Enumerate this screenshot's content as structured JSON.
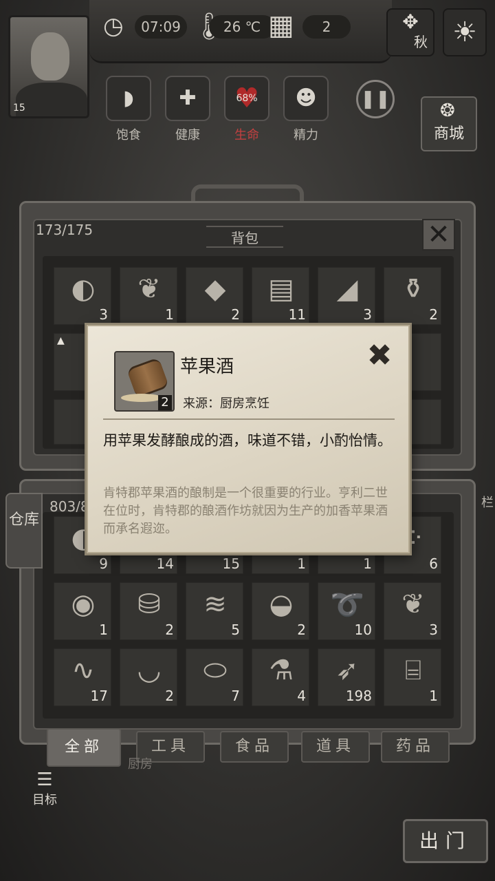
{
  "hud": {
    "time": "07:09",
    "temperature": "26 ℃",
    "day": "2",
    "season": "秋",
    "player_level": "15",
    "stats": [
      {
        "label": "饱食",
        "icon": "stomach-icon",
        "glyph": "◗",
        "value": ""
      },
      {
        "label": "健康",
        "icon": "health-cross-icon",
        "glyph": "✚",
        "value": ""
      },
      {
        "label": "生命",
        "icon": "heart-icon",
        "glyph": "♥",
        "value": "68%"
      },
      {
        "label": "精力",
        "icon": "energy-person-icon",
        "glyph": "☻",
        "value": ""
      }
    ],
    "shop_label": "商城"
  },
  "backpack": {
    "title": "背包",
    "capacity": "173/175",
    "slots": [
      {
        "name": "bread",
        "glyph": "◐",
        "qty": "3"
      },
      {
        "name": "herb-branch",
        "glyph": "❦",
        "qty": "1"
      },
      {
        "name": "stone",
        "glyph": "◆",
        "qty": "2"
      },
      {
        "name": "wood-planks",
        "glyph": "▤",
        "qty": "11"
      },
      {
        "name": "stone-shard",
        "glyph": "◢",
        "qty": "3"
      },
      {
        "name": "bottle",
        "glyph": "⚱",
        "qty": "2"
      }
    ]
  },
  "warehouse": {
    "tab_label": "仓库",
    "capacity_visible": "803/8",
    "row1_qty": [
      "9",
      "14",
      "15",
      "1",
      "1",
      "6"
    ],
    "slots": [
      {
        "name": "soup-bowl",
        "glyph": "◉",
        "qty": "1"
      },
      {
        "name": "apple-cider",
        "glyph": "⛁",
        "qty": "2"
      },
      {
        "name": "cloth",
        "glyph": "≋",
        "qty": "5"
      },
      {
        "name": "grain-bowl",
        "glyph": "◒",
        "qty": "2"
      },
      {
        "name": "rope",
        "glyph": "➰",
        "qty": "10"
      },
      {
        "name": "herb-branch",
        "glyph": "❦",
        "qty": "3"
      },
      {
        "name": "bandage",
        "glyph": "∿",
        "qty": "17"
      },
      {
        "name": "bowl",
        "glyph": "◡",
        "qty": "2"
      },
      {
        "name": "pills",
        "glyph": "⬭",
        "qty": "7"
      },
      {
        "name": "jar",
        "glyph": "⚗",
        "qty": "4"
      },
      {
        "name": "arrows",
        "glyph": "➶",
        "qty": "198"
      },
      {
        "name": "thread-spool",
        "glyph": "⌸",
        "qty": "1"
      }
    ]
  },
  "filters": [
    {
      "label": "全部",
      "active": true
    },
    {
      "label": "工具",
      "active": false
    },
    {
      "label": "食品",
      "active": false
    },
    {
      "label": "道具",
      "active": false
    },
    {
      "label": "药品",
      "active": false
    }
  ],
  "bottom": {
    "goal_label": "目标",
    "kitchen_label": "厨房",
    "fence_label": "栏",
    "exit_label": "出门"
  },
  "popup": {
    "item_name": "苹果酒",
    "qty": "2",
    "source": "来源：厨房烹饪",
    "description": "用苹果发酵酿成的酒，味道不错，小酌怡情。",
    "lore": "肯特郡苹果酒的酿制是一个很重要的行业。亨利二世在位时，肯特郡的酿酒作坊就因为生产的加香苹果酒而承名遐迩。"
  }
}
